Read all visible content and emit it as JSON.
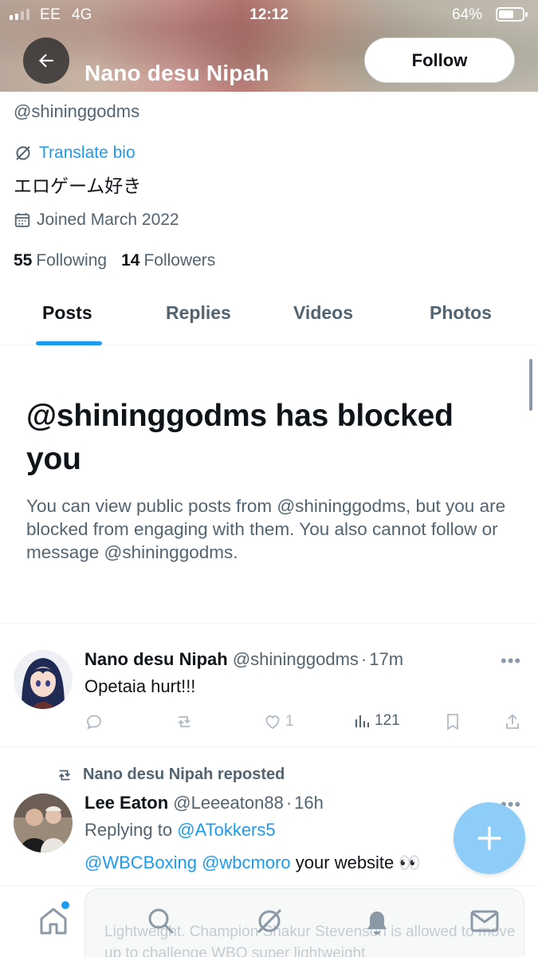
{
  "status_bar": {
    "carrier": "EE",
    "network": "4G",
    "time": "12:12",
    "battery_percent": "64%",
    "battery_level": 0.64
  },
  "header": {
    "display_name": "Nano desu Nipah",
    "follow_label": "Follow"
  },
  "profile": {
    "handle": "@shininggodms",
    "translate_label": "Translate bio",
    "bio": "エロゲーム好き",
    "joined": "Joined March 2022",
    "following_count": "55",
    "following_label": "Following",
    "followers_count": "14",
    "followers_label": "Followers"
  },
  "tabs": [
    {
      "label": "Posts",
      "active": true
    },
    {
      "label": "Replies",
      "active": false
    },
    {
      "label": "Videos",
      "active": false
    },
    {
      "label": "Photos",
      "active": false
    }
  ],
  "blocked": {
    "title": "@shininggodms has blocked you",
    "body": "You can view public posts from @shininggodms, but you are blocked from engaging with them. You also cannot follow or message @shininggodms."
  },
  "posts": [
    {
      "name": "Nano desu Nipah",
      "handle": "@shininggodms",
      "separator": "·",
      "time": "17m",
      "text": "Opetaia hurt!!!",
      "likes": "1",
      "views": "121"
    },
    {
      "repost_label": "Nano desu Nipah reposted",
      "name": "Lee Eaton",
      "handle": "@Leeeaton88",
      "separator": "·",
      "time": "16h",
      "replying_prefix": "Replying to",
      "replying_to": "@ATokkers5",
      "mention1": "@WBCBoxing",
      "mention2": "@wbcmoro",
      "text": "your website 👀"
    }
  ],
  "peek_card": {
    "text": "Lightweight. Champion Shakur Stevenson is allowed to move up to challenge WBO super lightweight"
  },
  "colors": {
    "accent": "#1d9bf0",
    "text_primary": "#0f1419",
    "text_secondary": "#536471",
    "fab": "#8ecdf8"
  },
  "icons": {
    "back": "arrow-left-icon",
    "translate": "globe-slash-icon",
    "joined": "calendar-icon",
    "fab": "plus-icon",
    "nav": [
      "home-icon",
      "search-icon",
      "grok-icon",
      "bell-icon",
      "mail-icon"
    ]
  }
}
